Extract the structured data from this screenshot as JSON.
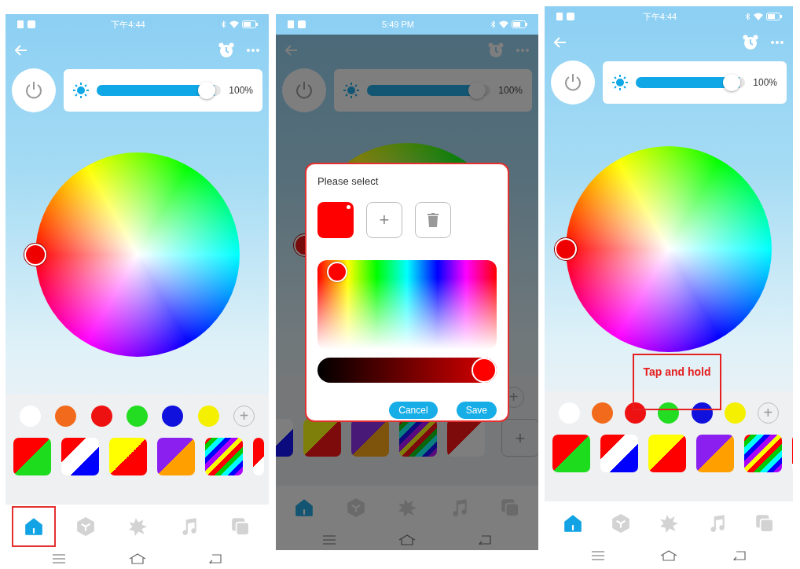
{
  "panels": [
    {
      "status_time": "下午4:44",
      "dimmed": false,
      "brightness": {
        "level": 0.95,
        "reading": "100%"
      },
      "swatches": [
        {
          "color": "#ffffff"
        },
        {
          "color": "#f26a1b"
        },
        {
          "color": "#ee1111"
        },
        {
          "color": "#22dd22"
        },
        {
          "color": "#1111dd"
        },
        {
          "color": "#f5f000"
        }
      ],
      "swatch_add": "+",
      "presets": [
        {
          "kind": "red-green"
        },
        {
          "kind": "white-blue"
        },
        {
          "kind": "yellow-red"
        },
        {
          "kind": "purple-orange"
        },
        {
          "kind": "stripes"
        },
        {
          "kind": "red-partial"
        }
      ],
      "tabs": [
        {
          "kind": "home",
          "selected": true
        },
        {
          "kind": "cube",
          "selected": false
        },
        {
          "kind": "splash",
          "selected": false
        },
        {
          "kind": "music",
          "selected": false
        },
        {
          "kind": "copy",
          "selected": false
        }
      ],
      "annotation": {
        "kind": "tab-highlight"
      }
    },
    {
      "status_time": "5:49 PM",
      "dimmed": true,
      "brightness": {
        "level": 0.95,
        "reading": "100%"
      },
      "swatch_add": "+",
      "presets": [
        {
          "kind": "blue-partial"
        },
        {
          "kind": "yellow-red"
        },
        {
          "kind": "purple-orange"
        },
        {
          "kind": "stripes"
        },
        {
          "kind": "red-white"
        },
        {
          "kind": "add",
          "label": "+"
        }
      ],
      "tabs": [
        {
          "kind": "home",
          "selected": true
        },
        {
          "kind": "cube",
          "selected": false
        },
        {
          "kind": "splash",
          "selected": false
        },
        {
          "kind": "music",
          "selected": false
        },
        {
          "kind": "copy",
          "selected": false
        }
      ],
      "dialog": {
        "title": "Please select",
        "add_label": "+",
        "value_slider": {
          "level": 1
        },
        "buttons": [
          "Cancel",
          "Save"
        ]
      }
    },
    {
      "status_time": "下午4:44",
      "dimmed": false,
      "brightness": {
        "level": 0.95,
        "reading": "100%"
      },
      "swatches": [
        {
          "color": "#ffffff"
        },
        {
          "color": "#f26a1b"
        },
        {
          "color": "#ee1111"
        },
        {
          "color": "#22dd22"
        },
        {
          "color": "#1111dd"
        },
        {
          "color": "#f5f000"
        }
      ],
      "swatch_add": "+",
      "presets": [
        {
          "kind": "red-green"
        },
        {
          "kind": "white-blue"
        },
        {
          "kind": "yellow-red"
        },
        {
          "kind": "purple-orange"
        },
        {
          "kind": "stripes"
        },
        {
          "kind": "red-partial"
        }
      ],
      "tabs": [
        {
          "kind": "home",
          "selected": true
        },
        {
          "kind": "cube",
          "selected": false
        },
        {
          "kind": "splash",
          "selected": false
        },
        {
          "kind": "music",
          "selected": false
        },
        {
          "kind": "copy",
          "selected": false
        }
      ],
      "annotation": {
        "kind": "callout",
        "text": "Tap and hold"
      }
    }
  ]
}
